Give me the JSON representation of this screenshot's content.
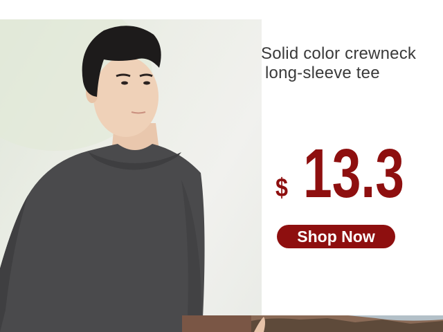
{
  "product": {
    "title_line1": "Solid color crewneck",
    "title_line2": "long-sleeve tee",
    "price_currency": "$",
    "price_amount": "13.3",
    "cta_label": "Shop Now"
  },
  "colors": {
    "accent": "#8e0f0f",
    "title_text": "#3a3a3a",
    "tee": "#4a4a4c"
  },
  "images": {
    "model_photo": "man-in-dark-grey-long-sleeve-tee",
    "next_banner": "outdoor-banner-preview"
  }
}
